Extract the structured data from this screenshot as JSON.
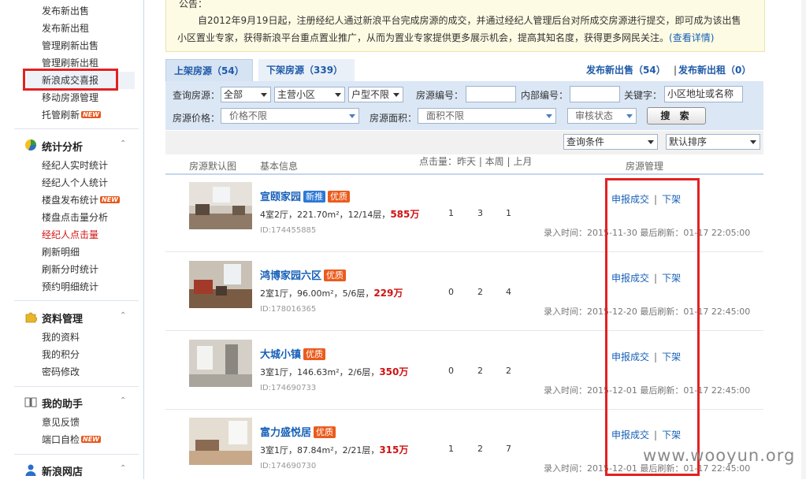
{
  "sidebar": {
    "top_links": [
      "发布新出售",
      "发布新出租",
      "管理刷新出售",
      "管理刷新出租",
      "新浪成交喜报",
      "移动房源管理",
      "托管刷新"
    ],
    "sections": [
      {
        "title": "统计分析",
        "items": [
          "经纪人实时统计",
          "经纪人个人统计",
          "楼盘发布统计",
          "楼盘点击量分析",
          "经纪人点击量",
          "刷新明细",
          "刷新分时统计",
          "预约明细统计"
        ]
      },
      {
        "title": "资料管理",
        "items": [
          "我的资料",
          "我的积分",
          "密码修改"
        ]
      },
      {
        "title": "我的助手",
        "items": [
          "意见反馈",
          "端口自检"
        ]
      },
      {
        "title": "新浪网店",
        "items": []
      }
    ],
    "new_badge": "NEW",
    "caret": "⌃"
  },
  "notice": {
    "title": "公告：",
    "line1": "自2012年9月19日起，注册经纪人通过新浪平台完成房源的成交，并通过经纪人管理后台对所成交房源进行提交，即可成为该出售",
    "line2": "小区置业专家，获得新浪平台重点置业推广，从而为置业专家提供更多展示机会，提高其知名度，获得更多网民关注。",
    "more": "(查看详情)"
  },
  "tabs": {
    "active": "上架房源（54）",
    "inactive": "下架房源（339）",
    "pub_sale": "发布新出售（54）",
    "pub_sep": "|",
    "pub_rent": "发布新出租（0）"
  },
  "filters": {
    "query_label": "查询房源：",
    "sel_all": "全部",
    "sel_community": "主营小区",
    "sel_layout": "户型不限",
    "code_label": "房源编号：",
    "inner_label": "内部编号：",
    "keyword_label": "关键字：",
    "keyword_placeholder": "小区地址或名称",
    "price_label": "房源价格：",
    "price_value": "价格不限",
    "area_label": "房源面积：",
    "area_value": "面积不限",
    "audit_value": "审核状态",
    "search_btn": "搜 索"
  },
  "sortbar": {
    "cond": "查询条件",
    "order": "默认排序"
  },
  "columns": {
    "image": "房源默认图",
    "basic": "基本信息",
    "clicks": "点击量：昨天 | 本周 | 上月",
    "manage": "房源管理"
  },
  "listings": [
    {
      "name": "宣颐家园",
      "tags": [
        "新推",
        "优质"
      ],
      "layout": "4室2厅，221.70m²，12/14层，",
      "price": "585万",
      "id": "ID:174455885",
      "yesterday": "1",
      "week": "3",
      "month": "1",
      "time": "录入时间：2015-11-30  最后刷新：01-17 22:05:00"
    },
    {
      "name": "鸿博家园六区",
      "tags": [
        "优质"
      ],
      "layout": "2室1厅，96.00m²，5/6层，",
      "price": "229万",
      "id": "ID:178016365",
      "yesterday": "0",
      "week": "2",
      "month": "4",
      "time": "录入时间：2015-12-20  最后刷新：01-17 22:45:00"
    },
    {
      "name": "大城小镇",
      "tags": [
        "优质"
      ],
      "layout": "3室1厅，146.63m²，2/6层，",
      "price": "350万",
      "id": "ID:174690733",
      "yesterday": "0",
      "week": "2",
      "month": "2",
      "time": "录入时间：2015-12-01  最后刷新：01-17 22:45:00"
    },
    {
      "name": "富力盛悦居",
      "tags": [
        "优质"
      ],
      "layout": "3室1厅，87.84m²，2/21层，",
      "price": "315万",
      "id": "ID:174690730",
      "yesterday": "1",
      "week": "2",
      "month": "7",
      "time": "录入时间：2015-12-01  最后刷新：01-17 22:45:00"
    }
  ],
  "actions": {
    "report": "申报成交",
    "sep": "|",
    "offline": "下架"
  },
  "watermark": "www.wooyun.org",
  "colors": {
    "link": "#1760b8",
    "highlight_box": "#e32121",
    "price": "#d01212"
  }
}
